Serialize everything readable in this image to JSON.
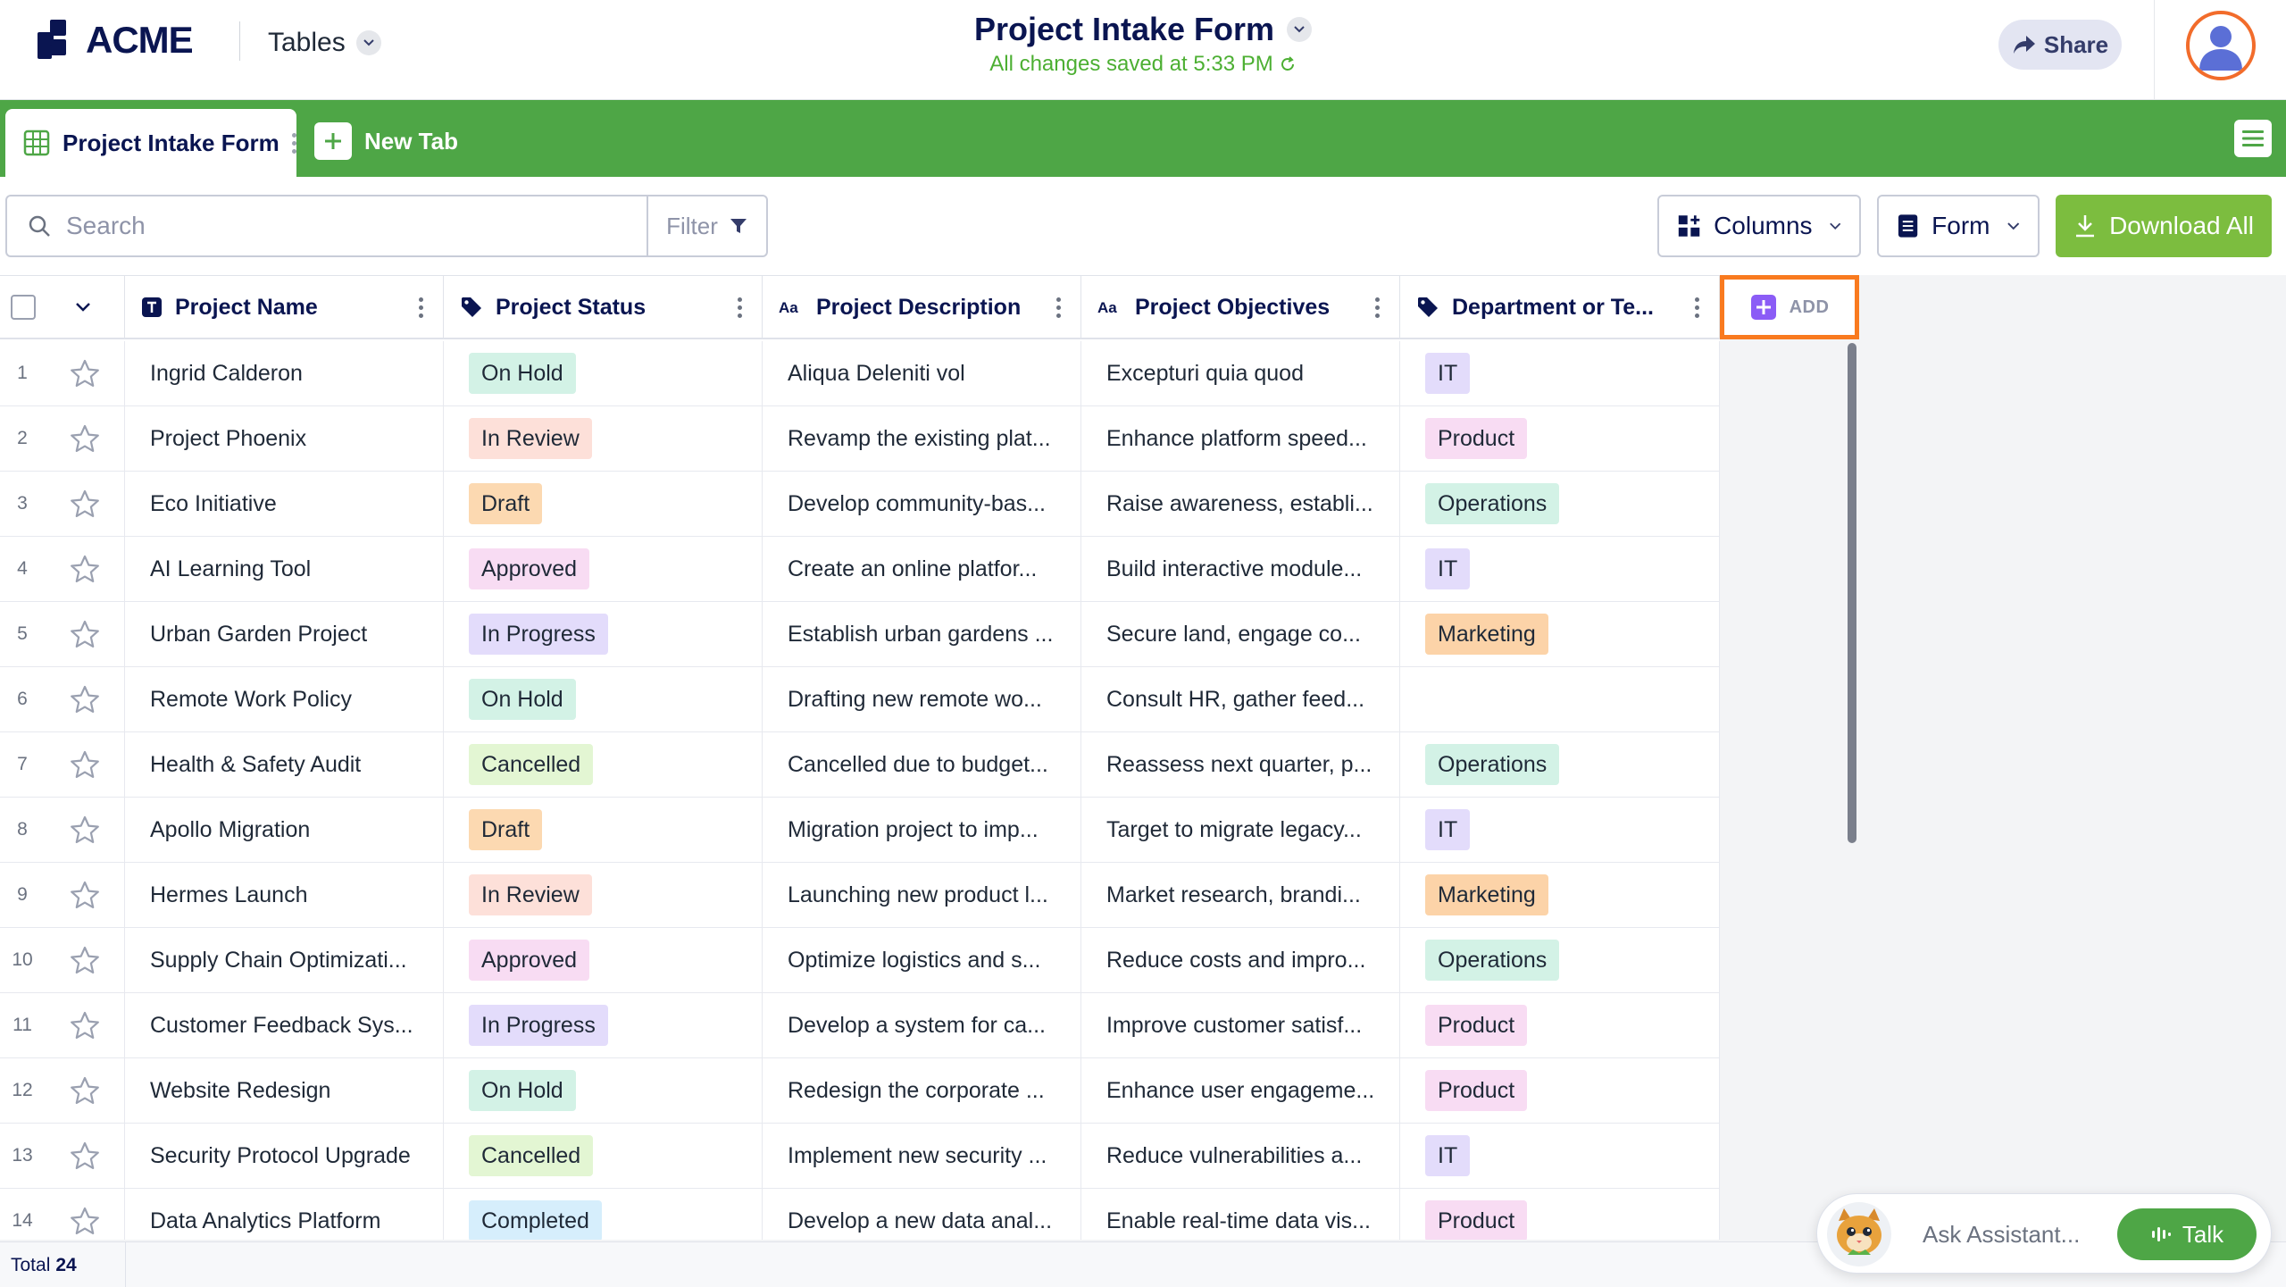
{
  "header": {
    "logo_text": "ACME",
    "nav_dropdown_label": "Tables",
    "title": "Project Intake Form",
    "save_status": "All changes saved at 5:33 PM",
    "share_label": "Share"
  },
  "tabs": {
    "active_label": "Project Intake Form",
    "new_tab_label": "New Tab"
  },
  "toolbar": {
    "search_placeholder": "Search",
    "filter_label": "Filter",
    "columns_label": "Columns",
    "form_label": "Form",
    "download_label": "Download All"
  },
  "table": {
    "columns": [
      {
        "label": "Project Name",
        "icon": "text-type-icon"
      },
      {
        "label": "Project Status",
        "icon": "tag-icon"
      },
      {
        "label": "Project Description",
        "icon": "aa-text-icon"
      },
      {
        "label": "Project Objectives",
        "icon": "aa-text-icon"
      },
      {
        "label": "Department or Te...",
        "icon": "tag-icon"
      }
    ],
    "add_column_label": "ADD",
    "rows": [
      {
        "num": "1",
        "name": "Ingrid Calderon",
        "status": "On Hold",
        "description": "Aliqua Deleniti vol",
        "objectives": "Excepturi quia quod",
        "department": "IT"
      },
      {
        "num": "2",
        "name": "Project Phoenix",
        "status": "In Review",
        "description": "Revamp the existing plat...",
        "objectives": "Enhance platform speed...",
        "department": "Product"
      },
      {
        "num": "3",
        "name": "Eco Initiative",
        "status": "Draft",
        "description": "Develop community-bas...",
        "objectives": "Raise awareness, establi...",
        "department": "Operations"
      },
      {
        "num": "4",
        "name": "AI Learning Tool",
        "status": "Approved",
        "description": "Create an online platfor...",
        "objectives": "Build interactive module...",
        "department": "IT"
      },
      {
        "num": "5",
        "name": "Urban Garden Project",
        "status": "In Progress",
        "description": "Establish urban gardens ...",
        "objectives": "Secure land, engage co...",
        "department": "Marketing"
      },
      {
        "num": "6",
        "name": "Remote Work Policy",
        "status": "On Hold",
        "description": "Drafting new remote wo...",
        "objectives": "Consult HR, gather feed...",
        "department": ""
      },
      {
        "num": "7",
        "name": "Health & Safety Audit",
        "status": "Cancelled",
        "description": "Cancelled due to budget...",
        "objectives": "Reassess next quarter, p...",
        "department": "Operations"
      },
      {
        "num": "8",
        "name": "Apollo Migration",
        "status": "Draft",
        "description": "Migration project to imp...",
        "objectives": "Target to migrate legacy...",
        "department": "IT"
      },
      {
        "num": "9",
        "name": "Hermes Launch",
        "status": "In Review",
        "description": "Launching new product l...",
        "objectives": "Market research, brandi...",
        "department": "Marketing"
      },
      {
        "num": "10",
        "name": "Supply Chain Optimizati...",
        "status": "Approved",
        "description": "Optimize logistics and s...",
        "objectives": "Reduce costs and impro...",
        "department": "Operations"
      },
      {
        "num": "11",
        "name": "Customer Feedback Sys...",
        "status": "In Progress",
        "description": "Develop a system for ca...",
        "objectives": "Improve customer satisf...",
        "department": "Product"
      },
      {
        "num": "12",
        "name": "Website Redesign",
        "status": "On Hold",
        "description": "Redesign the corporate ...",
        "objectives": "Enhance user engageme...",
        "department": "Product"
      },
      {
        "num": "13",
        "name": "Security Protocol Upgrade",
        "status": "Cancelled",
        "description": "Implement new security ...",
        "objectives": "Reduce vulnerabilities a...",
        "department": "IT"
      },
      {
        "num": "14",
        "name": "Data Analytics Platform",
        "status": "Completed",
        "description": "Develop a new data anal...",
        "objectives": "Enable real-time data vis...",
        "department": "Product"
      }
    ],
    "status_colors": {
      "On Hold": {
        "bg": "#d3f2e6",
        "fg": "#1f2937"
      },
      "In Review": {
        "bg": "#fde0d9",
        "fg": "#1f2937"
      },
      "Draft": {
        "bg": "#fcd9b1",
        "fg": "#1f2937"
      },
      "Approved": {
        "bg": "#f8dcf3",
        "fg": "#1f2937"
      },
      "In Progress": {
        "bg": "#e3dcfb",
        "fg": "#1f2937"
      },
      "Cancelled": {
        "bg": "#e3f6d3",
        "fg": "#1f2937"
      },
      "Completed": {
        "bg": "#d6eefc",
        "fg": "#1f2937"
      }
    },
    "department_colors": {
      "IT": {
        "bg": "#e3dcfb",
        "fg": "#1f2937"
      },
      "Product": {
        "bg": "#f8dcf3",
        "fg": "#1f2937"
      },
      "Operations": {
        "bg": "#d3f2e6",
        "fg": "#1f2937"
      },
      "Marketing": {
        "bg": "#fcd3a8",
        "fg": "#1f2937"
      }
    }
  },
  "footer": {
    "total_label": "Total",
    "total_count": "24"
  },
  "assistant": {
    "ask_label": "Ask Assistant...",
    "talk_label": "Talk"
  },
  "colors": {
    "brand_green": "#4ea646",
    "navy": "#0a1551",
    "accent_orange": "#f97a1f",
    "download_green": "#7cbd3f"
  }
}
